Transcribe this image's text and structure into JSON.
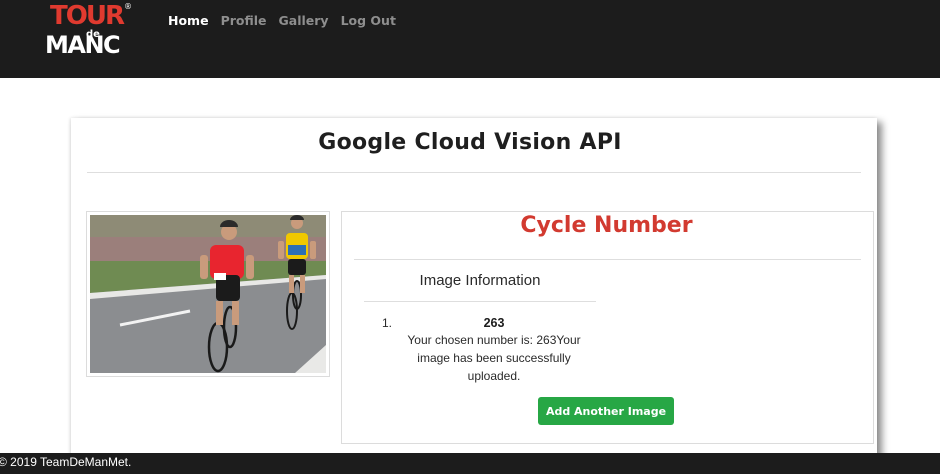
{
  "navbar": {
    "logo": {
      "line1": "TOUR",
      "line2": "de",
      "line3": "MANC",
      "mark": "®"
    },
    "links": [
      {
        "label": "Home",
        "active": true
      },
      {
        "label": "Profile",
        "active": false
      },
      {
        "label": "Gallery",
        "active": false
      },
      {
        "label": "Log Out",
        "active": false
      }
    ]
  },
  "page": {
    "title": "Google Cloud Vision API"
  },
  "photo": {
    "icon": "cyclists-photo"
  },
  "result": {
    "heading": "Cycle Number",
    "section_title": "Image Information",
    "list_marker": "1.",
    "number": "263",
    "message": "Your chosen number is: 263Your image has been successfully uploaded.",
    "button_label": "Add Another Image"
  },
  "footer": {
    "text": "© 2019 TeamDeManMet."
  },
  "colors": {
    "navbar_bg": "#1c1c1c",
    "accent_red": "#d23a30",
    "button_green": "#27a745"
  }
}
